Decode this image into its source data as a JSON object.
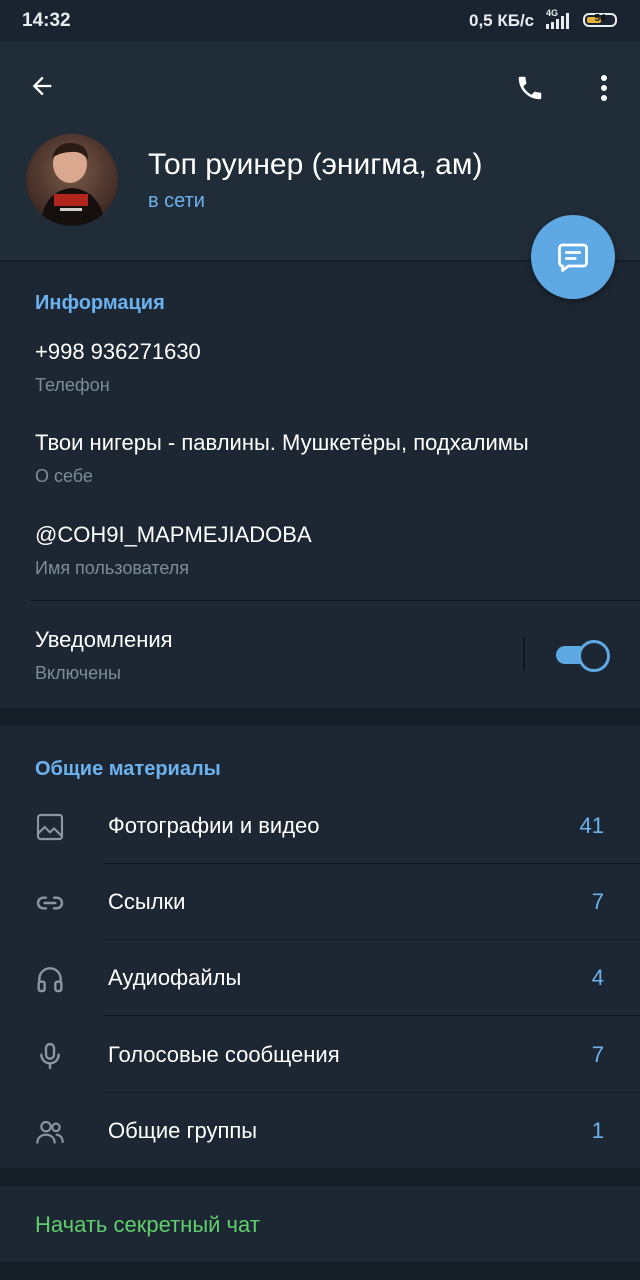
{
  "status_bar": {
    "time": "14:32",
    "speed": "0,5 КБ/с",
    "network": "4G",
    "battery": "54",
    "battery_color": "#e5b23a"
  },
  "header": {
    "back_icon": "arrow-left-icon",
    "call_icon": "phone-icon",
    "more_icon": "more-vert-icon",
    "name": "Топ руинер (энигма, ам)",
    "status": "в сети"
  },
  "fab": {
    "icon": "message-icon"
  },
  "info": {
    "title": "Информация",
    "phone": "+998 936271630",
    "phone_label": "Телефон",
    "bio": "Твои нигеры - павлины. Мушкетёры, подхалимы",
    "bio_label": "О себе",
    "username": "@COH9I_MAPMEJIADOBA",
    "username_label": "Имя пользователя",
    "notifications": "Уведомления",
    "notifications_state": "Включены",
    "notifications_on": true
  },
  "shared": {
    "title": "Общие материалы",
    "items": [
      {
        "icon": "photo-icon",
        "label": "Фотографии и видео",
        "count": "41"
      },
      {
        "icon": "link-icon",
        "label": "Ссылки",
        "count": "7"
      },
      {
        "icon": "headphones-icon",
        "label": "Аудиофайлы",
        "count": "4"
      },
      {
        "icon": "microphone-icon",
        "label": "Голосовые сообщения",
        "count": "7"
      },
      {
        "icon": "group-icon",
        "label": "Общие группы",
        "count": "1"
      }
    ]
  },
  "secret_chat": {
    "label": "Начать секретный чат",
    "color": "#5fce6b"
  },
  "colors": {
    "accent": "#6cb2ee",
    "background": "#151e27",
    "header": "#202c38",
    "card": "#1d2733"
  }
}
